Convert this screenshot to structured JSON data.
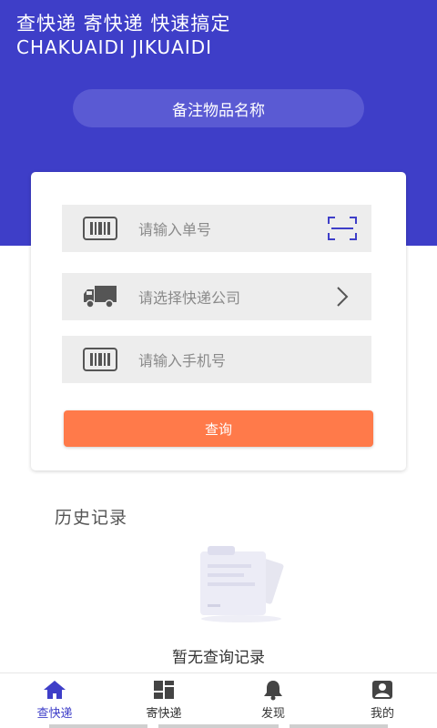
{
  "header": {
    "slogan": "查快递  寄快递  快速搞定",
    "slogan_en": "CHAKUAIDI  JIKUAIDI",
    "remark_button": "备注物品名称"
  },
  "form": {
    "tracking_placeholder": "请输入单号",
    "company_placeholder": "请选择快递公司",
    "phone_placeholder": "请输入手机号",
    "query_label": "查询"
  },
  "history": {
    "title": "历史记录",
    "empty_text": "暂无查询记录"
  },
  "tabs": [
    {
      "label": "查快递",
      "icon": "home-icon",
      "active": true
    },
    {
      "label": "寄快递",
      "icon": "grid-icon",
      "active": false
    },
    {
      "label": "发现",
      "icon": "bell-icon",
      "active": false
    },
    {
      "label": "我的",
      "icon": "profile-icon",
      "active": false
    }
  ],
  "colors": {
    "primary": "#3e3ec8",
    "button": "#ff7a4a",
    "field_bg": "#ededed"
  }
}
